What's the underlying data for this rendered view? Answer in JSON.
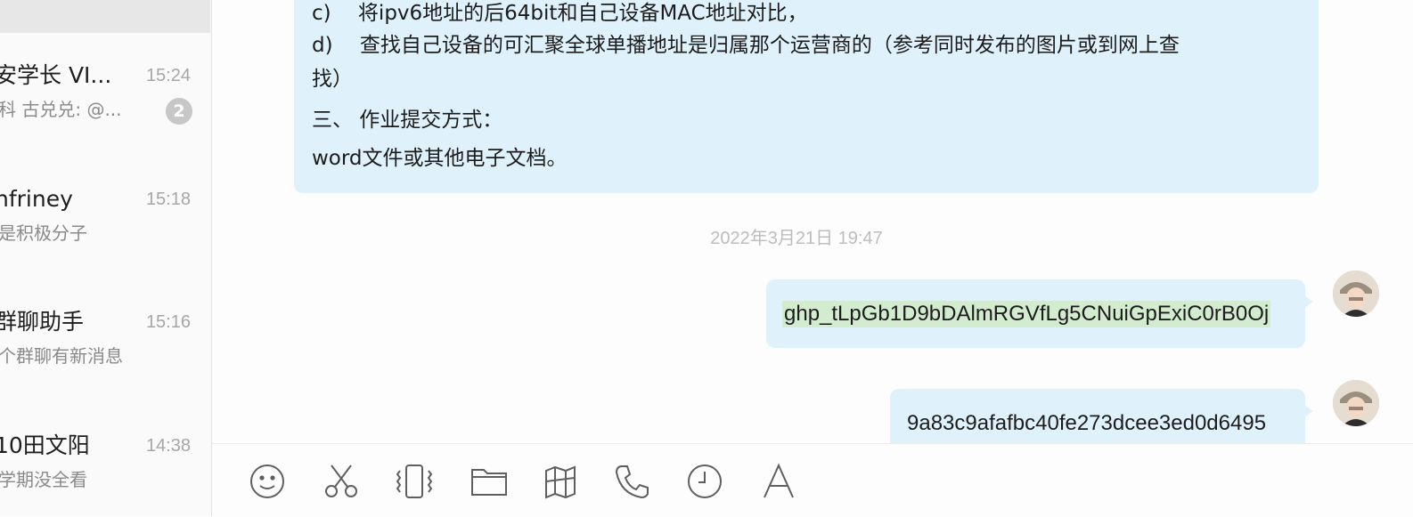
{
  "conversations": [
    {
      "name": "安学长 VI...",
      "time": "15:24",
      "preview": "科 古兑兑: @...",
      "badge": "2"
    },
    {
      "name": "nfriney",
      "time": "15:18",
      "preview": "是积极分子"
    },
    {
      "name": "群聊助手",
      "time": "15:16",
      "preview": "个群聊有新消息"
    },
    {
      "name": "10田文阳",
      "time": "14:38",
      "preview": "学期没全看"
    }
  ],
  "chat": {
    "incoming_lines": [
      "c)　 将ipv6地址的后64bit和自己设备MAC地址对比，",
      "d)　 查找自己设备的可汇聚全球单播地址是归属那个运营商的（参考同时发布的图片或到网上查",
      "找）",
      "三、 作业提交方式：",
      "word文件或其他电子文档。"
    ],
    "timestamp": "2022年3月21日  19:47",
    "outgoing": [
      {
        "text": "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"
      },
      {
        "text": "9a83c9afafbc40fe273dcee3ed0d6495"
      }
    ]
  },
  "toolbar": {
    "icons": [
      "emoji-icon",
      "scissors-icon",
      "shake-icon",
      "folder-icon",
      "map-icon",
      "phone-icon",
      "history-icon",
      "font-icon"
    ]
  },
  "colors": {
    "bubble": "#dff1fb",
    "highlight": "#d3ecd0",
    "badge": "#c7c7c7"
  }
}
